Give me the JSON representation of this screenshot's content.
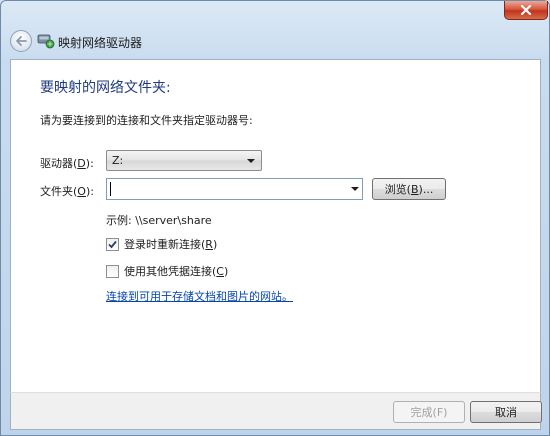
{
  "window": {
    "title": "映射网络驱动器"
  },
  "main": {
    "heading": "要映射的网络文件夹:",
    "instruction": "请为要连接到的连接和文件夹指定驱动器号:",
    "drive": {
      "label_pre": "驱动器(",
      "label_key": "D",
      "label_post": "):",
      "value": "Z:"
    },
    "folder": {
      "label_pre": "文件夹(",
      "label_key": "O",
      "label_post": "):",
      "value": "",
      "browse_pre": "浏览(",
      "browse_key": "B",
      "browse_post": ")..."
    },
    "example": "示例: \\\\server\\share",
    "reconnect": {
      "label_pre": "登录时重新连接(",
      "label_key": "R",
      "label_post": ")",
      "checked": true
    },
    "other_credentials": {
      "label_pre": "使用其他凭据连接(",
      "label_key": "C",
      "label_post": ")",
      "checked": false
    },
    "link": "连接到可用于存储文档和图片的网站。"
  },
  "footer": {
    "finish_label": "完成(F)",
    "cancel_label": "取消"
  },
  "colors": {
    "heading": "#1f3b82",
    "link": "#0645ad",
    "close_red": "#c1351c"
  },
  "icons": {
    "close": "close-icon",
    "back": "back-arrow-icon",
    "network_drive": "network-drive-icon",
    "dropdown": "chevron-down-icon",
    "checkmark": "checkmark-icon"
  }
}
